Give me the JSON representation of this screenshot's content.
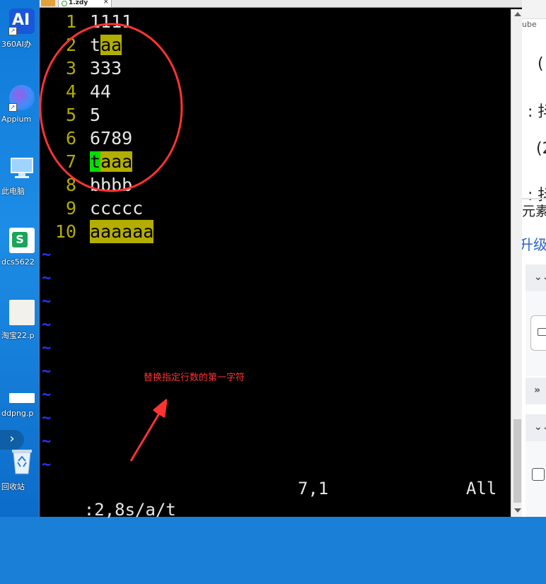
{
  "desktop": {
    "icons": [
      {
        "label": "360AI办",
        "icon": "ai-app-icon"
      },
      {
        "label": "Appium",
        "icon": "appium-icon"
      },
      {
        "label": "此电脑",
        "icon": "computer-icon"
      },
      {
        "label": "dcs5622",
        "icon": "spreadsheet-icon"
      },
      {
        "label": "淘宝22.p",
        "icon": "image-file-icon"
      },
      {
        "label": "ddpng.p",
        "icon": "image-file-icon"
      },
      {
        "label": "回收站",
        "icon": "recycle-bin-icon"
      }
    ],
    "ai_badge": "AI",
    "sheet_badge": "S",
    "collapse_glyph": "›"
  },
  "vim": {
    "tab": {
      "label": "1.zdy",
      "close": "×"
    },
    "lines": [
      {
        "num": "1",
        "text": "1111"
      },
      {
        "num": "2",
        "text": "taa"
      },
      {
        "num": "3",
        "text": "333"
      },
      {
        "num": "4",
        "text": "44"
      },
      {
        "num": "5",
        "text": "5"
      },
      {
        "num": "6",
        "text": "6789"
      },
      {
        "num": "7",
        "text": "taaa"
      },
      {
        "num": "8",
        "text": "bbbb"
      },
      {
        "num": "9",
        "text": "ccccc"
      },
      {
        "num": "10",
        "text": "aaaaaa"
      }
    ],
    "tilde": "~",
    "command": ":2,8s/a/t",
    "position": "7,1",
    "scroll": "All",
    "colors": {
      "line_number": "#b3ad00",
      "search_highlight": "#b3ad00",
      "cursor": "#00e000",
      "tilde": "#2a33ff",
      "annotation": "#ff3333"
    }
  },
  "annotation": {
    "text": "替换指定行数的第一字符"
  },
  "browser_panel": {
    "fragments": {
      "tab": "ube",
      "paren1": "(",
      "colon1": ": 抖",
      "paren2": "(2",
      "colon2": ": 抖",
      "elements": "元素",
      "level": "升级"
    }
  }
}
